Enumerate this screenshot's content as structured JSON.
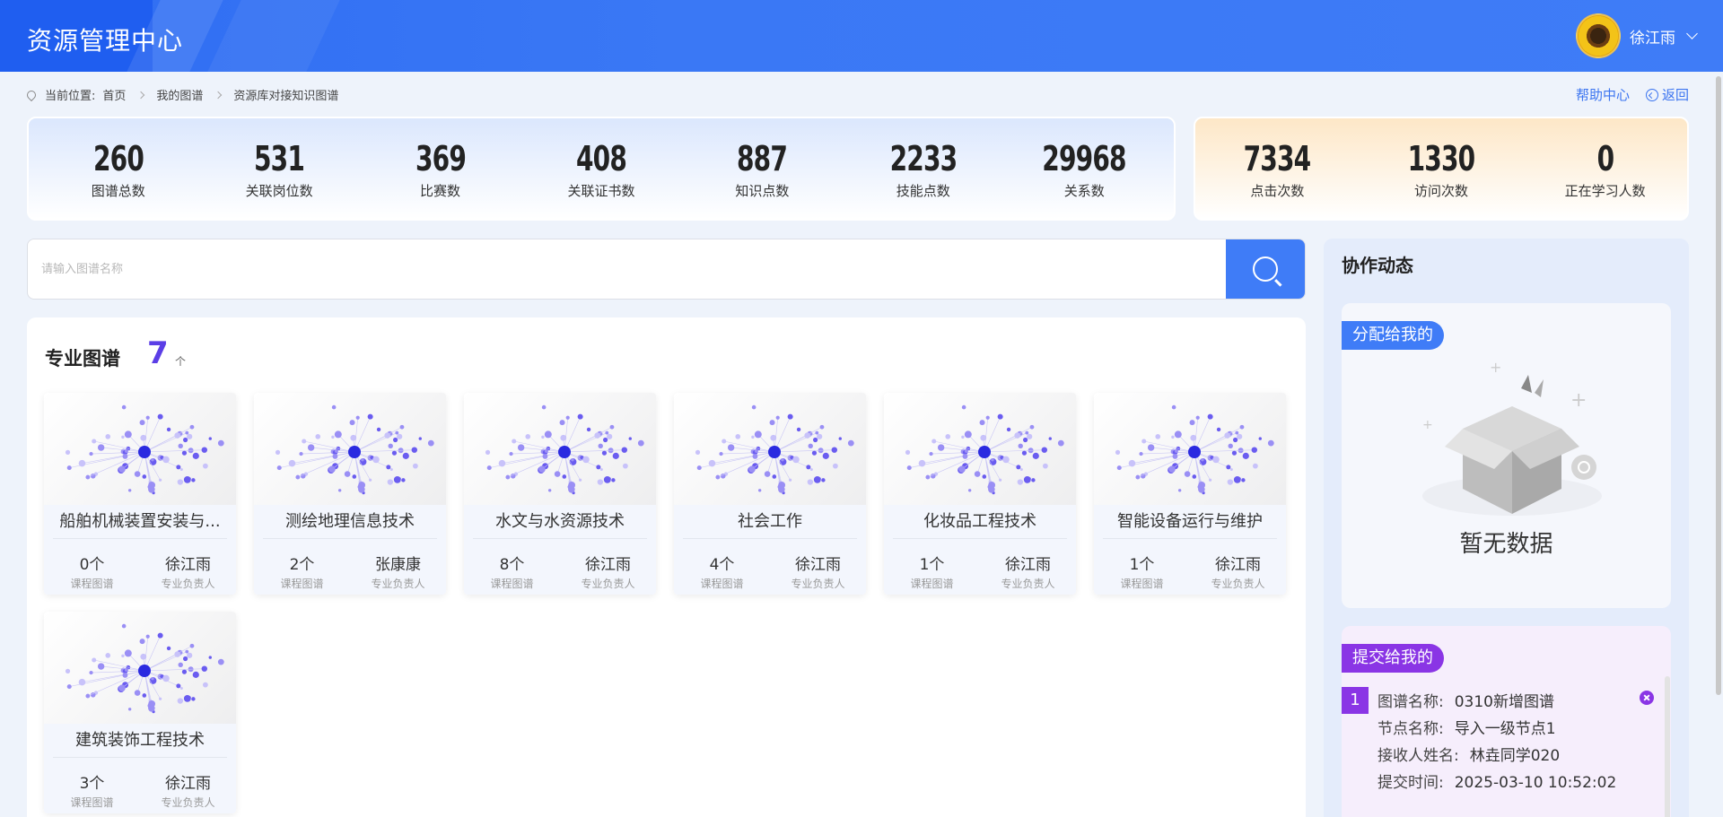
{
  "header": {
    "title": "资源管理中心",
    "user_name": "徐江雨"
  },
  "breadcrumb": {
    "prefix": "当前位置:",
    "items": [
      "首页",
      "我的图谱",
      "资源库对接知识图谱"
    ]
  },
  "top_links": {
    "help": "帮助中心",
    "back": "返回"
  },
  "stats_main": [
    {
      "value": "260",
      "label": "图谱总数"
    },
    {
      "value": "531",
      "label": "关联岗位数"
    },
    {
      "value": "369",
      "label": "比赛数"
    },
    {
      "value": "408",
      "label": "关联证书数"
    },
    {
      "value": "887",
      "label": "知识点数"
    },
    {
      "value": "2233",
      "label": "技能点数"
    },
    {
      "value": "29968",
      "label": "关系数"
    }
  ],
  "stats_visits": [
    {
      "value": "7334",
      "label": "点击次数"
    },
    {
      "value": "1330",
      "label": "访问次数"
    },
    {
      "value": "0",
      "label": "正在学习人数"
    }
  ],
  "search": {
    "placeholder": "请输入图谱名称"
  },
  "section": {
    "title": "专业图谱",
    "count": "7",
    "unit": "个"
  },
  "cards": [
    {
      "name": "船舶机械装置安装与...",
      "course_count": "0个",
      "course_label": "课程图谱",
      "owner": "徐江雨",
      "owner_label": "专业负责人"
    },
    {
      "name": "测绘地理信息技术",
      "course_count": "2个",
      "course_label": "课程图谱",
      "owner": "张康康",
      "owner_label": "专业负责人"
    },
    {
      "name": "水文与水资源技术",
      "course_count": "8个",
      "course_label": "课程图谱",
      "owner": "徐江雨",
      "owner_label": "专业负责人"
    },
    {
      "name": "社会工作",
      "course_count": "4个",
      "course_label": "课程图谱",
      "owner": "徐江雨",
      "owner_label": "专业负责人"
    },
    {
      "name": "化妆品工程技术",
      "course_count": "1个",
      "course_label": "课程图谱",
      "owner": "徐江雨",
      "owner_label": "专业负责人"
    },
    {
      "name": "智能设备运行与维护",
      "course_count": "1个",
      "course_label": "课程图谱",
      "owner": "徐江雨",
      "owner_label": "专业负责人"
    },
    {
      "name": "建筑装饰工程技术",
      "course_count": "3个",
      "course_label": "课程图谱",
      "owner": "徐江雨",
      "owner_label": "专业负责人"
    }
  ],
  "side": {
    "title": "协作动态",
    "assigned": {
      "label": "分配给我的",
      "empty_text": "暂无数据"
    },
    "submitted": {
      "label": "提交给我的",
      "items": [
        {
          "index": "1",
          "graph_key": "图谱名称:",
          "graph_val": "0310新增图谱",
          "node_key": "节点名称:",
          "node_val": "导入一级节点1",
          "receiver_key": "接收人姓名:",
          "receiver_val": "林垚同学020",
          "time_key": "提交时间:",
          "time_val": "2025-03-10 10:52:02"
        }
      ]
    }
  },
  "colors": {
    "primary": "#3f7cf7",
    "count_purple": "#5b3ee6",
    "submit_purple": "#8a35e5"
  }
}
